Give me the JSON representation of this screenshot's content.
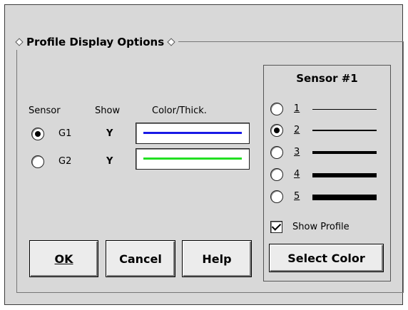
{
  "dialog": {
    "group_title": "Profile Display Options",
    "columns": {
      "sensor": "Sensor",
      "show": "Show",
      "color_thick": "Color/Thick."
    },
    "rows": [
      {
        "name": "G1",
        "show": "Y",
        "selected": true,
        "line_color": "#1a1ae6"
      },
      {
        "name": "G2",
        "show": "Y",
        "selected": false,
        "line_color": "#22e022"
      }
    ],
    "sensor_panel": {
      "title": "Sensor #1",
      "thickness_options": [
        {
          "label": "1",
          "selected": false
        },
        {
          "label": "2",
          "selected": true
        },
        {
          "label": "3",
          "selected": false
        },
        {
          "label": "4",
          "selected": false
        },
        {
          "label": "5",
          "selected": false
        }
      ],
      "show_profile_label": "Show Profile",
      "show_profile_checked": true,
      "select_color_label": "Select Color"
    },
    "buttons": {
      "ok": "OK",
      "cancel": "Cancel",
      "help": "Help"
    }
  }
}
